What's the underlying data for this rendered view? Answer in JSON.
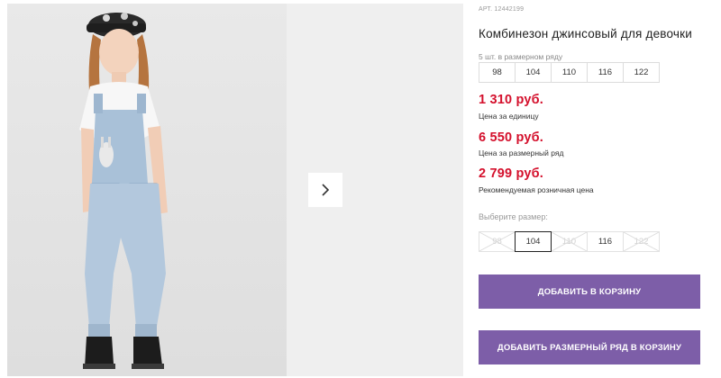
{
  "product": {
    "sku": "АРТ. 12442199",
    "title": "Комбинезон джинсовый для девочки",
    "pack_label": "5 шт. в размерном ряду",
    "pack_sizes": [
      "98",
      "104",
      "110",
      "116",
      "122"
    ]
  },
  "prices": [
    {
      "value": "1 310 руб.",
      "note": "Цена за единицу"
    },
    {
      "value": "6 550 руб.",
      "note": "Цена за размерный ряд"
    },
    {
      "value": "2 799 руб.",
      "note": "Рекомендуемая розничная цена"
    }
  ],
  "size_selector": {
    "label": "Выберите размер:",
    "sizes": [
      {
        "label": "98",
        "state": "disabled"
      },
      {
        "label": "104",
        "state": "selected"
      },
      {
        "label": "110",
        "state": "disabled"
      },
      {
        "label": "116",
        "state": "available"
      },
      {
        "label": "122",
        "state": "disabled"
      }
    ]
  },
  "actions": {
    "add_to_cart": "ДОБАВИТЬ В КОРЗИНУ",
    "add_pack_to_cart": "ДОБАВИТЬ РАЗМЕРНЫЙ РЯД В КОРЗИНУ"
  },
  "gallery": {
    "next_icon": "chevron-right-icon"
  },
  "colors": {
    "price": "#d4102c",
    "button": "#7d5ea8"
  }
}
